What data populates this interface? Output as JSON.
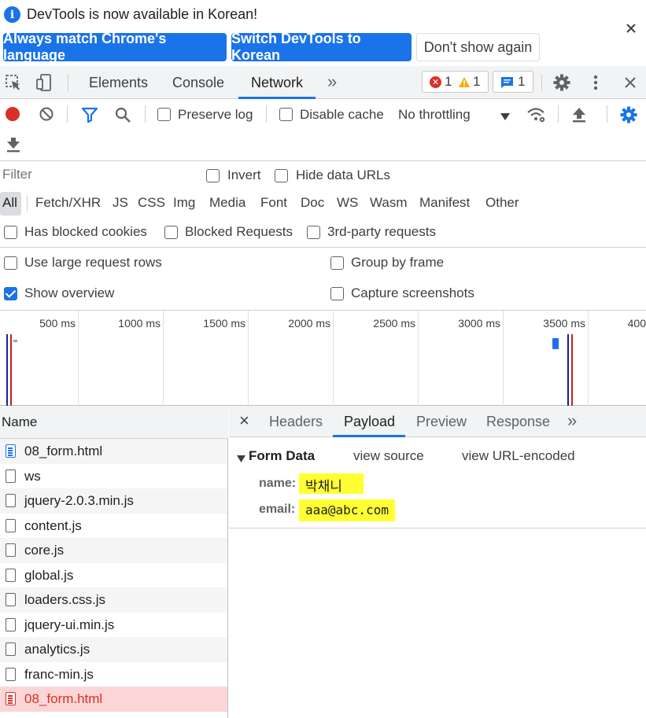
{
  "infobar": {
    "message": "DevTools is now available in Korean!",
    "buttons": {
      "match_language": "Always match Chrome's language",
      "switch_korean": "Switch DevTools to Korean",
      "dont_show": "Don't show again"
    },
    "info_icon": "info-icon",
    "close_icon": "close-icon"
  },
  "main_tabs": {
    "tabs": [
      "Elements",
      "Console",
      "Network"
    ],
    "active": "Network",
    "more_glyph": "»",
    "error_count": "1",
    "warning_count": "1",
    "message_count": "1"
  },
  "network_toolbar": {
    "preserve_log": "Preserve log",
    "disable_cache": "Disable cache",
    "throttling": "No throttling",
    "preserve_log_checked": false,
    "disable_cache_checked": false
  },
  "filter": {
    "placeholder": "Filter",
    "invert": "Invert",
    "hide_data_urls": "Hide data URLs",
    "types": [
      "All",
      "Fetch/XHR",
      "JS",
      "CSS",
      "Img",
      "Media",
      "Font",
      "Doc",
      "WS",
      "Wasm",
      "Manifest",
      "Other"
    ],
    "active_type": "All",
    "has_blocked_cookies": "Has blocked cookies",
    "blocked_requests": "Blocked Requests",
    "third_party": "3rd-party requests"
  },
  "settings": {
    "use_large_rows": "Use large request rows",
    "group_by_frame": "Group by frame",
    "show_overview": "Show overview",
    "capture_screenshots": "Capture screenshots",
    "show_overview_checked": true
  },
  "overview": {
    "ticks": [
      "500 ms",
      "1000 ms",
      "1500 ms",
      "2000 ms",
      "2500 ms",
      "3000 ms",
      "3500 ms",
      "400"
    ]
  },
  "request_list": {
    "header": "Name",
    "rows": [
      {
        "name": "08_form.html",
        "type": "doc"
      },
      {
        "name": "ws",
        "type": "file"
      },
      {
        "name": "jquery-2.0.3.min.js",
        "type": "file"
      },
      {
        "name": "content.js",
        "type": "file"
      },
      {
        "name": "core.js",
        "type": "file"
      },
      {
        "name": "global.js",
        "type": "file"
      },
      {
        "name": "loaders.css.js",
        "type": "file"
      },
      {
        "name": "jquery-ui.min.js",
        "type": "file"
      },
      {
        "name": "analytics.js",
        "type": "file"
      },
      {
        "name": "franc-min.js",
        "type": "file"
      },
      {
        "name": "08_form.html",
        "type": "doc",
        "error": true
      }
    ]
  },
  "detail": {
    "tabs": [
      "Headers",
      "Payload",
      "Preview",
      "Response"
    ],
    "active": "Payload",
    "more_glyph": "»",
    "close_glyph": "×",
    "form_data_title": "Form Data",
    "view_source": "view source",
    "view_url_encoded": "view URL-encoded",
    "fields": [
      {
        "key": "name:",
        "value": "박채니"
      },
      {
        "key": "email:",
        "value": "aaa@abc.com"
      }
    ],
    "highlight_color": "#ffff33"
  },
  "colors": {
    "accent": "#1a73e8",
    "error": "#d93025",
    "warning": "#f9ab00"
  }
}
